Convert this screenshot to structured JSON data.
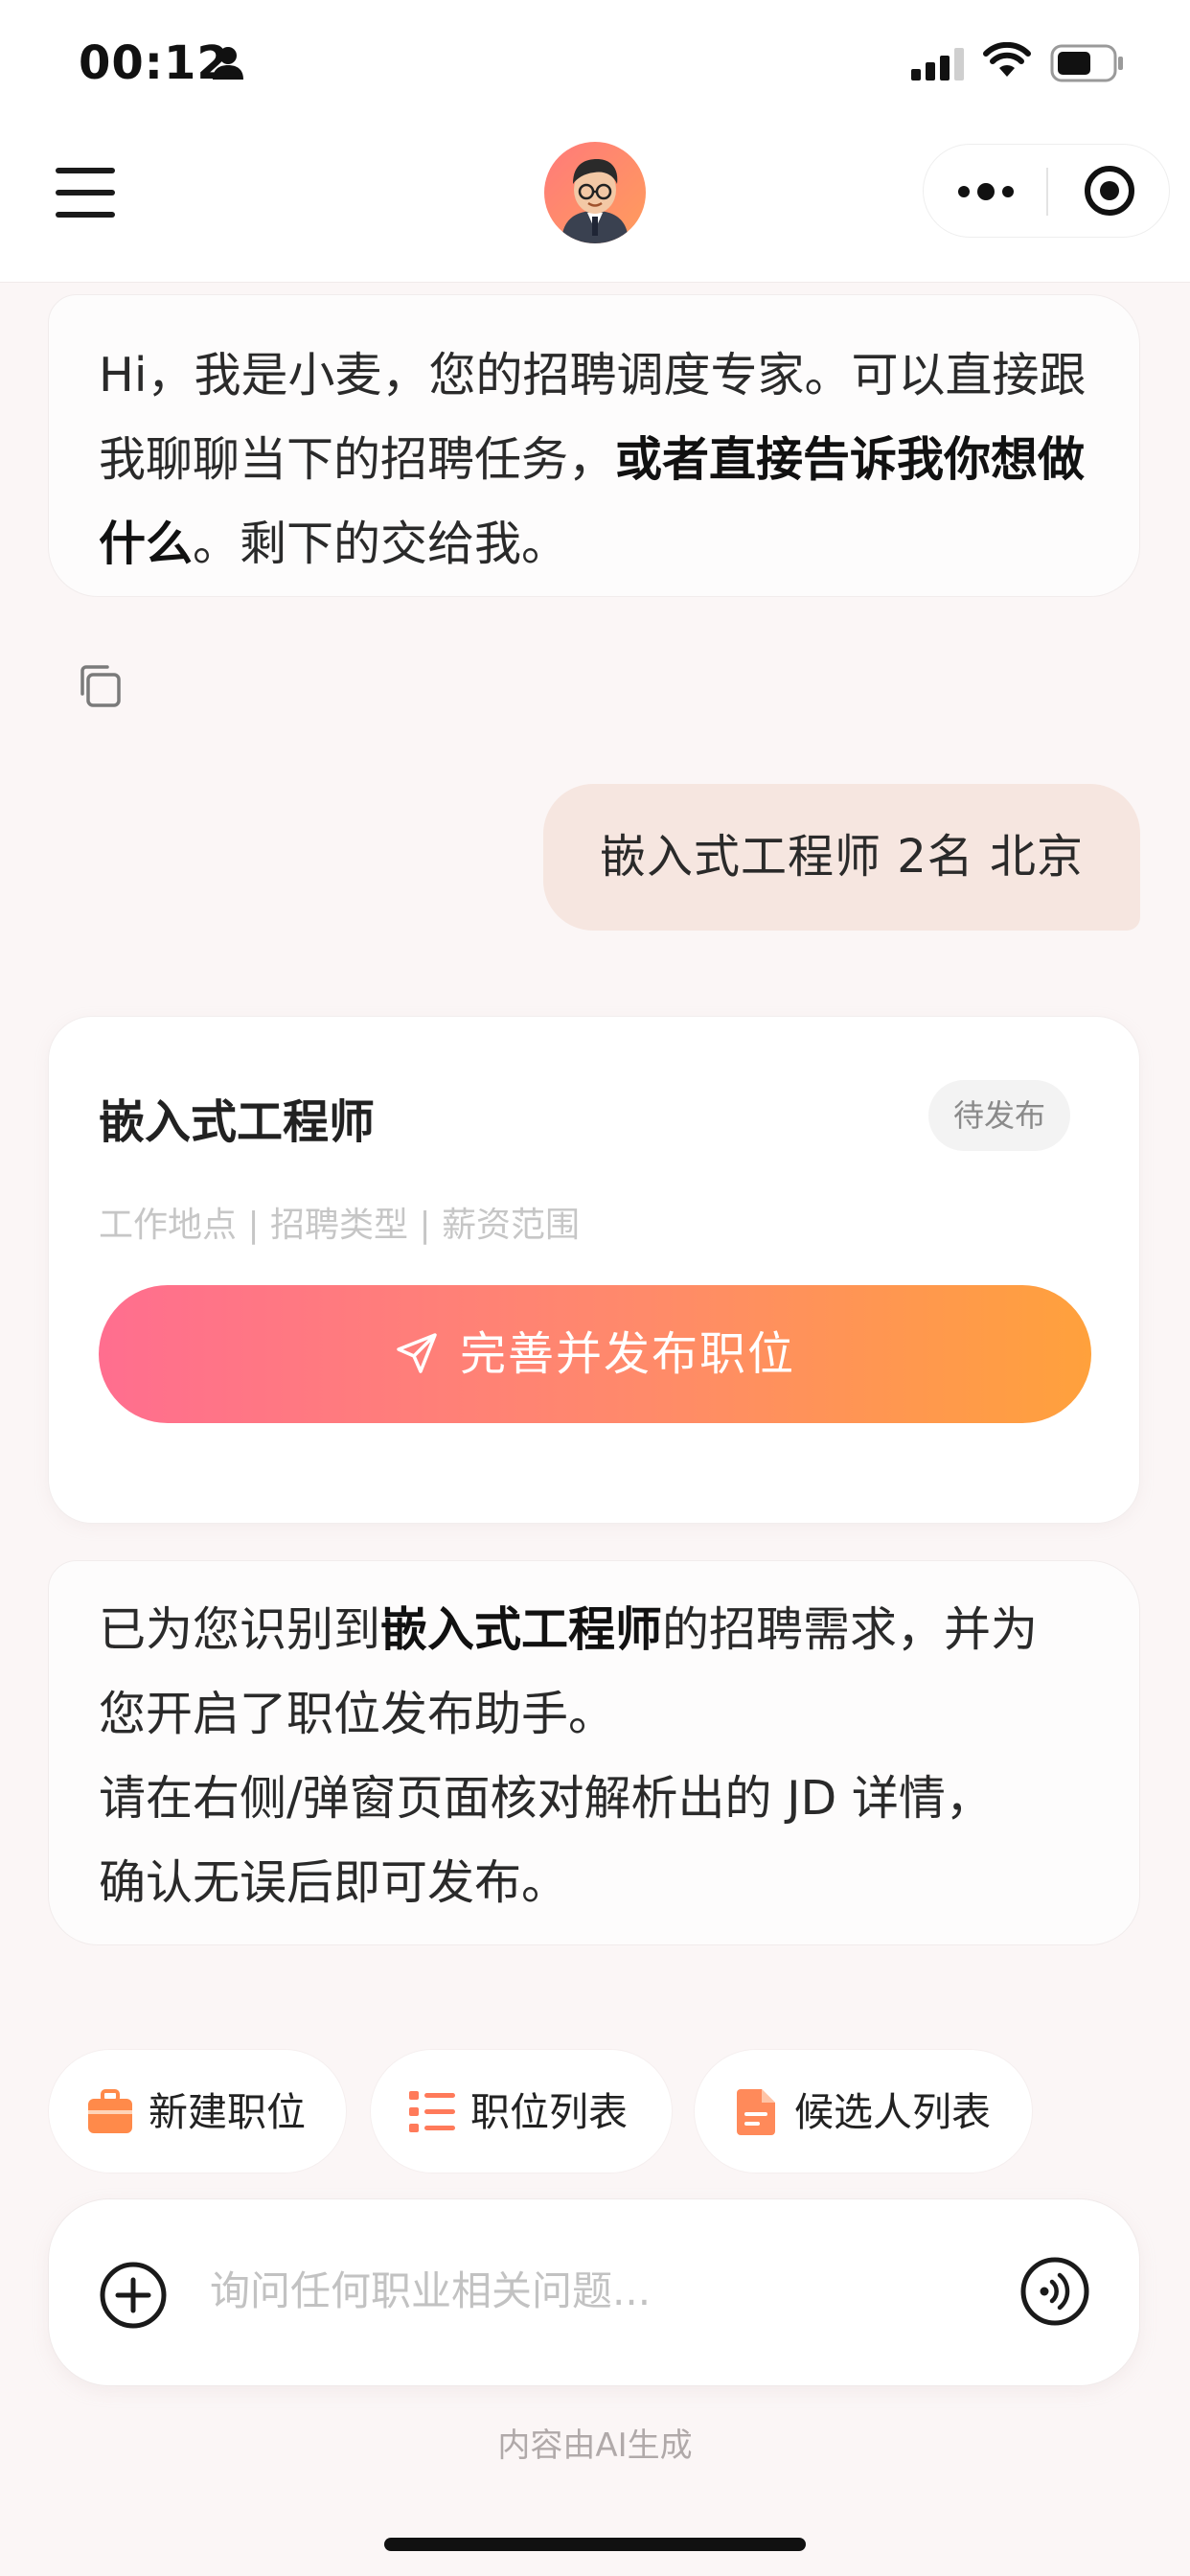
{
  "status_bar": {
    "time": "00:12"
  },
  "chat": {
    "ai_greeting": {
      "part1": "Hi，我是小麦，您的招聘调度专家。可以直接跟我聊聊当下的招聘任务，",
      "bold": "或者直接告诉我你想做什么",
      "part2": "。剩下的交给我。"
    },
    "user_message": "嵌入式工程师 2名 北京",
    "job_card": {
      "title": "嵌入式工程师",
      "status": "待发布",
      "meta_placeholder": "工作地点 | 招聘类型 | 薪资范围",
      "publish_label": "完善并发布职位"
    },
    "ai_reply": {
      "line1_pre": "已为您识别到",
      "line1_bold": "嵌入式工程师",
      "line1_post": "的招聘需求，并为",
      "line2": "您开启了职位发布助手。",
      "line3": "请在右侧/弹窗页面核对解析出的 JD 详情，",
      "line4": "确认无误后即可发布。"
    }
  },
  "quick_actions": [
    {
      "label": "新建职位",
      "icon": "briefcase-icon"
    },
    {
      "label": "职位列表",
      "icon": "list-icon"
    },
    {
      "label": "候选人列表",
      "icon": "document-icon"
    }
  ],
  "input": {
    "placeholder": "询问任何职业相关问题..."
  },
  "footer_note": "内容由AI生成",
  "colors": {
    "background": "#fbf6f6",
    "user_bubble": "#f6e6e0",
    "button_gradient_start": "#ff6e8f",
    "button_gradient_end": "#ffa13c"
  }
}
